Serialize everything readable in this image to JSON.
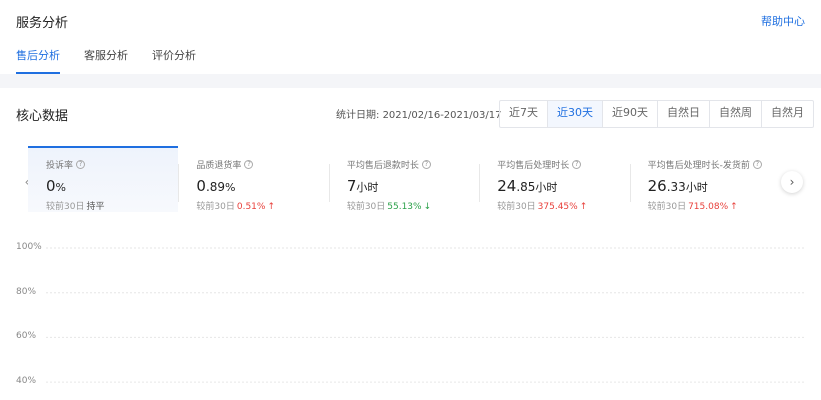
{
  "header": {
    "title": "服务分析",
    "help_link": "帮助中心",
    "tabs": [
      {
        "label": "售后分析",
        "active": true
      },
      {
        "label": "客服分析",
        "active": false
      },
      {
        "label": "评价分析",
        "active": false
      }
    ]
  },
  "core": {
    "title": "核心数据",
    "date_label": "统计日期:",
    "date_range": "2021/02/16-2021/03/17",
    "ranges": [
      "近7天",
      "近30天",
      "近90天",
      "自然日",
      "自然周",
      "自然月"
    ],
    "active_range": "近30天"
  },
  "metrics": [
    {
      "label": "投诉率",
      "value_int": "0",
      "value_frac": "",
      "value_unit": "%",
      "compare_prefix": "较前30日",
      "compare_value": "持平",
      "trend": "flat"
    },
    {
      "label": "品质退货率",
      "value_int": "0",
      "value_frac": ".89",
      "value_unit": "%",
      "compare_prefix": "较前30日",
      "compare_value": "0.51%",
      "trend": "up"
    },
    {
      "label": "平均售后退款时长",
      "value_int": "7",
      "value_frac": "",
      "value_unit": "小时",
      "compare_prefix": "较前30日",
      "compare_value": "55.13%",
      "trend": "down"
    },
    {
      "label": "平均售后处理时长",
      "value_int": "24",
      "value_frac": ".85",
      "value_unit": "小时",
      "compare_prefix": "较前30日",
      "compare_value": "375.45%",
      "trend": "up"
    },
    {
      "label": "平均售后处理时长-发货前",
      "value_int": "26",
      "value_frac": ".33",
      "value_unit": "小时",
      "compare_prefix": "较前30日",
      "compare_value": "715.08%",
      "trend": "up"
    }
  ],
  "icons": {
    "help": "question-circle-icon",
    "prev": "chevron-left-icon",
    "next": "chevron-right-icon",
    "up": "arrow-up-icon",
    "down": "arrow-down-icon"
  },
  "colors": {
    "accent": "#1f6fe0",
    "up": "#e8403b",
    "down": "#2ca14a"
  },
  "chart_data": {
    "type": "line",
    "y_ticks": [
      "100%",
      "80%",
      "60%",
      "40%"
    ],
    "y_values": [
      100,
      80,
      60,
      40
    ],
    "grid": true,
    "series": []
  }
}
